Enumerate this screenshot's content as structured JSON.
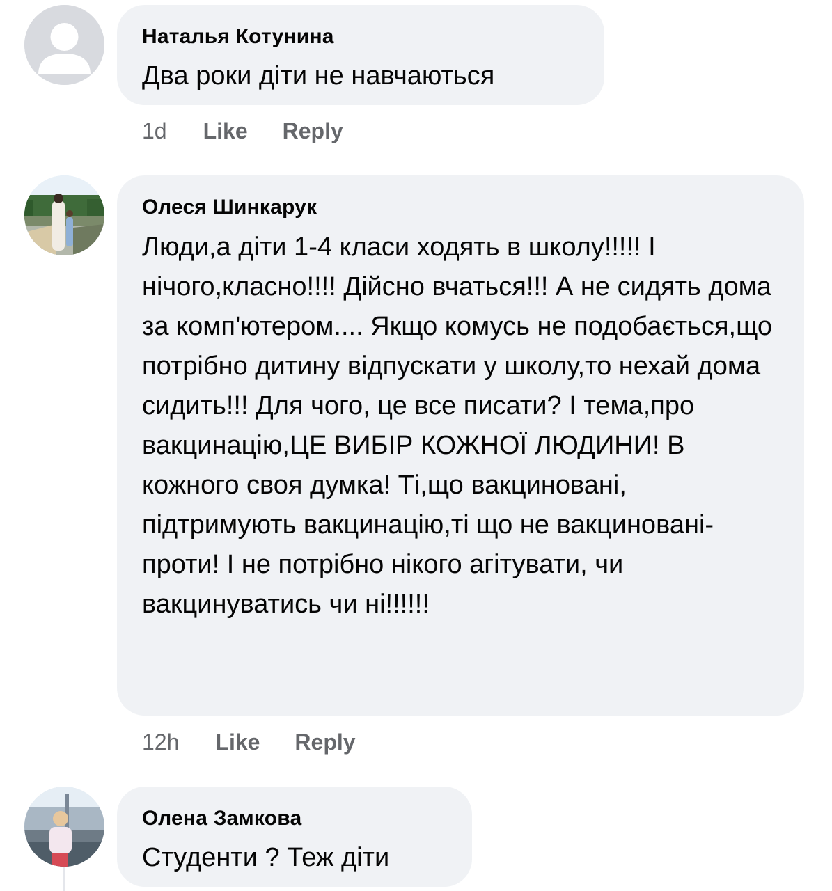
{
  "comments": [
    {
      "author": "Наталья Котунина",
      "text": "Два роки діти не навчаються",
      "time": "1d",
      "like": "Like",
      "reply": "Reply",
      "avatar": "default-avatar-icon"
    },
    {
      "author": "Олеся Шинкарук",
      "text": "Люди,а діти 1-4 класи ходять в школу!!!!! І нічого,класно!!!! Дійсно вчаться!!! А не сидять дома за комп'ютером.... Якщо комусь не подобається,що потрібно дитину відпускати у школу,то нехай дома сидить!!! Для чого, це все писати? І тема,про вакцинацію,ЦЕ ВИБІР КОЖНОЇ ЛЮДИНИ! В кожного своя думка! Ті,що вакциновані, підтримують вакцинацію,ті що не вакциновані-проти! І не потрібно нікого агітувати, чи вакцинуватись чи ні!!!!!!",
      "time": "12h",
      "like": "Like",
      "reply": "Reply",
      "avatar": "profile-photo"
    },
    {
      "author": "Олена Замкова",
      "text": "Студенти ? Теж діти",
      "avatar": "profile-photo"
    }
  ],
  "colors": {
    "bubble": "#f0f2f5",
    "meta": "#65676b",
    "text": "#050505"
  }
}
